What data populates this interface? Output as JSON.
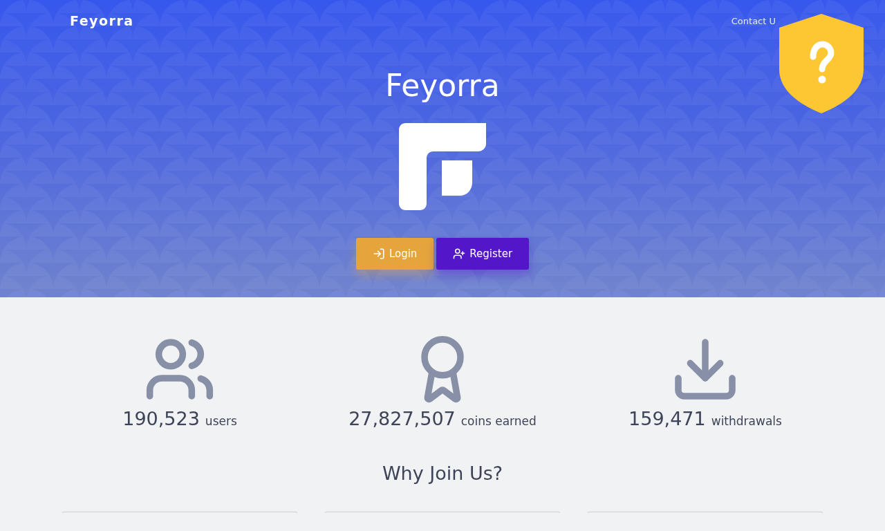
{
  "nav": {
    "brand": "Feyorra",
    "links": [
      "Contact U"
    ]
  },
  "hero": {
    "title": "Feyorra",
    "buttons": [
      {
        "kind": "login",
        "label": "Login"
      },
      {
        "kind": "register",
        "label": "Register"
      }
    ]
  },
  "stats": [
    {
      "kind": "users",
      "value": "190,523",
      "label": "users"
    },
    {
      "kind": "award",
      "value": "27,827,507",
      "label": "coins earned"
    },
    {
      "kind": "download",
      "value": "159,471",
      "label": "withdrawals"
    }
  ],
  "why": {
    "title": "Why Join Us?",
    "cards": [
      {
        "kind": "card"
      },
      {
        "kind": "card"
      },
      {
        "kind": "card"
      }
    ]
  }
}
